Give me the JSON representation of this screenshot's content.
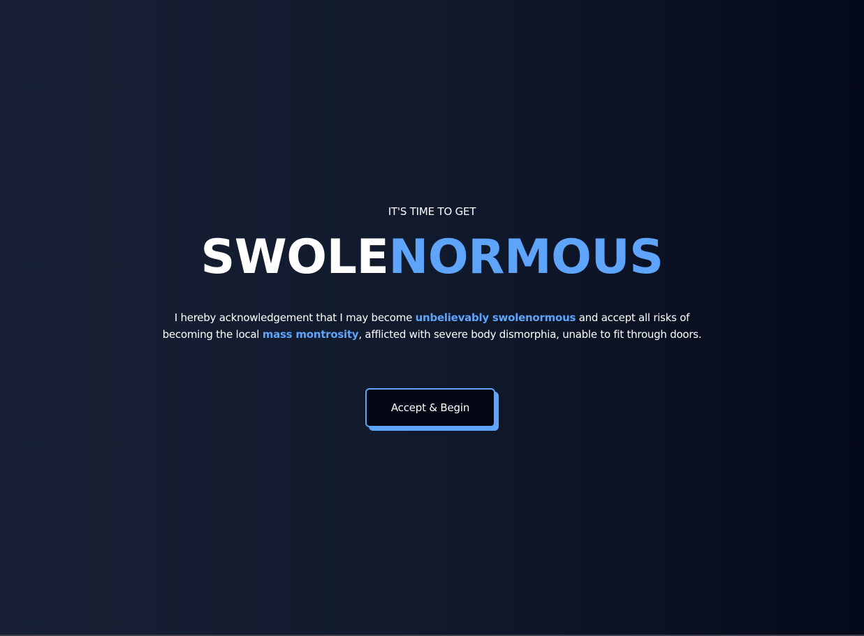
{
  "hero": {
    "kicker": "IT'S TIME TO GET",
    "title_white": "SWOLE",
    "title_blue": "NORMOUS",
    "body": {
      "part1": "I hereby acknowledgement that I may become ",
      "highlight1": "unbelievably swolenormous",
      "part2": " and accept all risks of becoming the local ",
      "highlight2": "mass montrosity",
      "part3": ", afflicted with severe body dismorphia, unable to fit through doors."
    },
    "button_label": "Accept & Begin"
  },
  "colors": {
    "accent": "#5ea4fa",
    "background_left": "#172034",
    "background_right": "#050a1a",
    "button_bg": "#040816"
  }
}
